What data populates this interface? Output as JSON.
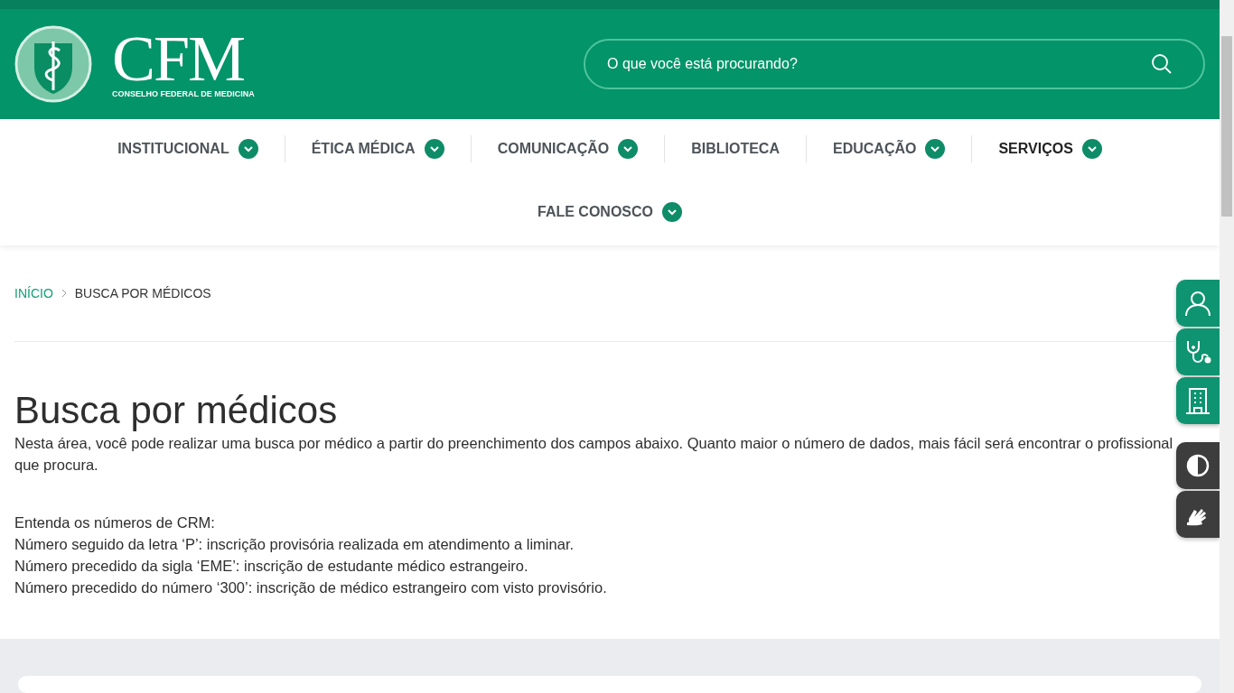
{
  "header": {
    "logo_title": "CFM",
    "logo_subtitle": "CONSELHO FEDERAL DE MEDICINA",
    "search": {
      "placeholder": "O que você está procurando?"
    }
  },
  "nav": [
    {
      "label": "INSTITUCIONAL",
      "dropdown": true,
      "selected": false
    },
    {
      "label": "ÉTICA MÉDICA",
      "dropdown": true,
      "selected": false
    },
    {
      "label": "COMUNICAÇÃO",
      "dropdown": true,
      "selected": false
    },
    {
      "label": "BIBLIOTECA",
      "dropdown": false,
      "selected": false
    },
    {
      "label": "EDUCAÇÃO",
      "dropdown": true,
      "selected": false
    },
    {
      "label": "SERVIÇOS",
      "dropdown": true,
      "selected": true
    },
    {
      "label": "FALE CONOSCO",
      "dropdown": true,
      "selected": false
    }
  ],
  "breadcrumb": [
    "INÍCIO",
    "BUSCA POR MÉDICOS"
  ],
  "title": "Busca por médicos",
  "intro": "Nesta área, você pode realizar uma busca por médico a partir do preenchimento dos campos abaixo. Quanto maior o número de dados, mais fácil será encontrar o profissional que procura.",
  "notes": [
    "Entenda os números de CRM:",
    "Número seguido da letra ‘P’: inscrição provisória realizada em atendimento a liminar.",
    "Número precedido da sigla ‘EME’: inscrição de estudante médico estrangeiro.",
    "Número precedido do número ‘300’: inscrição de médico estrangeiro com visto provisório."
  ],
  "side_buttons": [
    {
      "kind": "person",
      "color": "#0e9470"
    },
    {
      "kind": "stethoscope",
      "color": "#0e9470"
    },
    {
      "kind": "building",
      "color": "#0e9470"
    },
    {
      "kind": "contrast",
      "color": "#3d3d3d"
    },
    {
      "kind": "hands",
      "color": "#3d3d3d"
    }
  ]
}
